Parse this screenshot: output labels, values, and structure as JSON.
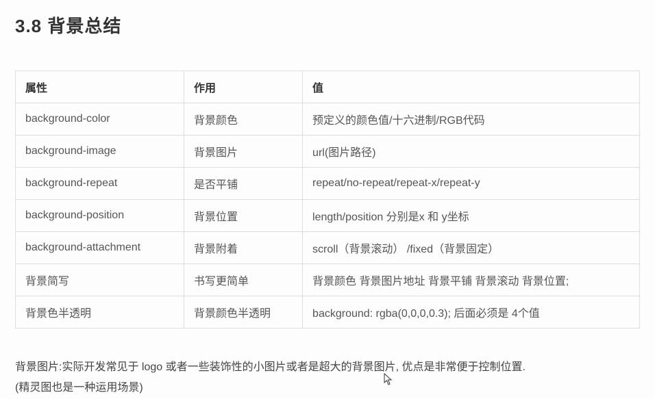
{
  "heading": "3.8 背景总结",
  "table": {
    "headers": [
      "属性",
      "作用",
      "值"
    ],
    "rows": [
      [
        "background-color",
        "背景颜色",
        "预定义的颜色值/十六进制/RGB代码"
      ],
      [
        "background-image",
        "背景图片",
        "url(图片路径)"
      ],
      [
        "background-repeat",
        "是否平铺",
        "repeat/no-repeat/repeat-x/repeat-y"
      ],
      [
        "background-position",
        "背景位置",
        "length/position   分别是x  和 y坐标"
      ],
      [
        "background-attachment",
        "背景附着",
        "scroll（背景滚动） /fixed（背景固定）"
      ],
      [
        "背景简写",
        "书写更简单",
        "背景颜色 背景图片地址 背景平铺 背景滚动 背景位置;"
      ],
      [
        "背景色半透明",
        "背景颜色半透明",
        "background: rgba(0,0,0,0.3);   后面必须是 4个值"
      ]
    ]
  },
  "note_line1": "背景图片:实际开发常见于 logo 或者一些装饰性的小图片或者是超大的背景图片, 优点是非常便于控制位置.",
  "note_line2": "(精灵图也是一种运用场景)"
}
